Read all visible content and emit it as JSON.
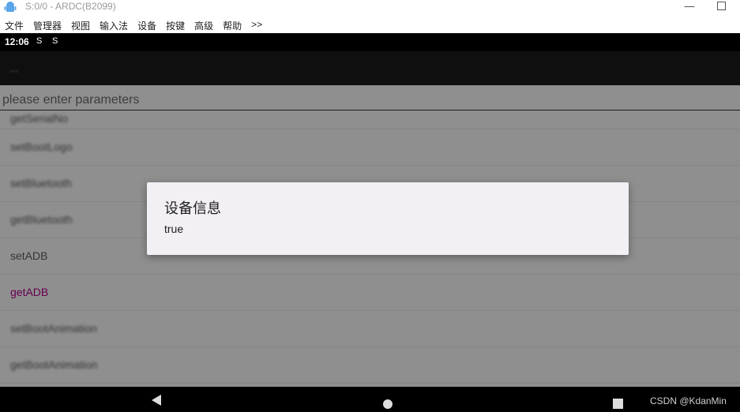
{
  "window": {
    "title": "S:0/0 - ARDC(B2099)",
    "minimize_glyph": "—"
  },
  "menu": {
    "items": [
      "文件",
      "管理器",
      "视图",
      "输入法",
      "设备",
      "按键",
      "高级",
      "帮助",
      ">>"
    ]
  },
  "statusbar": {
    "time": "12:06",
    "icons": [
      "S",
      "S"
    ]
  },
  "appbar": {
    "title": "..."
  },
  "input": {
    "placeholder": "please enter parameters"
  },
  "list": {
    "items": [
      "getSerialNo",
      "setBootLogo",
      "setBluetooth",
      "getBluetooth",
      "setADB",
      "getADB",
      "setBootAnimation",
      "getBootAnimation"
    ]
  },
  "dialog": {
    "title": "设备信息",
    "message": "true"
  },
  "watermark": "CSDN @KdanMin",
  "colors": {
    "accent_list_item": "#b0008b",
    "dialog_background": "#f2eff5",
    "statusbar": "#000000"
  }
}
